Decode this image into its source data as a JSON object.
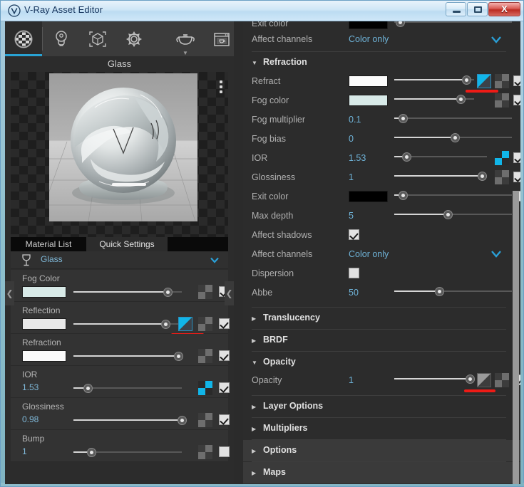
{
  "window": {
    "title": "V-Ray Asset Editor",
    "logo_icon": "vray-logo-icon",
    "minimize_label": "",
    "maximize_label": "",
    "close_label": "X"
  },
  "toolbar": {
    "items": [
      {
        "name": "materials-tab",
        "icon": "checkered-sphere-icon",
        "active": true
      },
      {
        "name": "lights-tab",
        "icon": "light-bulb-icon",
        "active": false
      },
      {
        "name": "geometry-tab",
        "icon": "cube-brackets-icon",
        "active": false
      },
      {
        "name": "settings-tab",
        "icon": "gear-icon",
        "active": false
      },
      {
        "name": "preview-shape-tab",
        "icon": "teapot-icon",
        "active": false
      },
      {
        "name": "render-view-tab",
        "icon": "render-window-icon",
        "active": false
      }
    ]
  },
  "left_panel": {
    "preview_title": "Glass",
    "options_icon": "vertical-dots-icon",
    "tabs": [
      {
        "label": "Material List",
        "active": false
      },
      {
        "label": "Quick Settings",
        "active": true
      }
    ],
    "material": {
      "icon": "wine-glass-icon",
      "name": "Glass",
      "expand_icon": "chevron-down-icon"
    },
    "params": [
      {
        "label": "Fog Color",
        "type": "color",
        "color": "#d8eae8",
        "slider": 0.86,
        "texture": "checker-slot",
        "texture_active": false,
        "gradient": null,
        "checked": true,
        "marked": false
      },
      {
        "label": "Reflection",
        "type": "color",
        "color": "#e8e8e8",
        "slider": 0.84,
        "texture": "checker-slot",
        "texture_active": false,
        "gradient": "gradient-slot",
        "gradient_active": true,
        "checked": true,
        "marked": true
      },
      {
        "label": "Refraction",
        "type": "color",
        "color": "#fbfbfb",
        "slider": 0.94,
        "texture": "checker-slot",
        "texture_active": false,
        "gradient": null,
        "checked": true,
        "marked": false
      },
      {
        "label": "IOR",
        "type": "value",
        "value": "1.53",
        "slider": 0.09,
        "texture": "checker-slot",
        "texture_active": true,
        "gradient": null,
        "checked": true,
        "marked": false
      },
      {
        "label": "Glossiness",
        "type": "value",
        "value": "0.98",
        "slider": 0.97,
        "texture": "checker-slot",
        "texture_active": false,
        "gradient": null,
        "checked": true,
        "marked": false
      },
      {
        "label": "Bump",
        "type": "value",
        "value": "1",
        "slider": 0.13,
        "texture": "checker-slot",
        "texture_active": false,
        "gradient": null,
        "checked": false,
        "marked": false
      }
    ],
    "collapse_icon": "chevron-left-icon"
  },
  "right_panel": {
    "collapse_icon": "chevron-left-icon",
    "top_partial": [
      {
        "label": "Exit color",
        "type": "color",
        "color": "#000000",
        "slider": 0.02,
        "checkbox": null
      },
      {
        "label": "Affect channels",
        "type": "dropdown",
        "value": "Color only",
        "caret": "chevron-down-icon"
      }
    ],
    "sections": [
      {
        "title": "Refraction",
        "expanded": true,
        "arrow": "triangle-down-icon",
        "highlight": false,
        "rows": [
          {
            "label": "Refract",
            "type": "color",
            "color": "#fbfbfb",
            "slider": 0.86,
            "gradient": "gradient-slot",
            "gradient_active": true,
            "texture": "checker-slot",
            "texture_active": false,
            "checked": true,
            "marked": true
          },
          {
            "label": "Fog color",
            "type": "color",
            "color": "#d8eae8",
            "slider": 0.8,
            "gradient": null,
            "texture": "checker-slot",
            "texture_active": false,
            "checked": true,
            "marked": false
          },
          {
            "label": "Fog multiplier",
            "type": "value",
            "value": "0.1",
            "slider": 0.035,
            "gradient": null,
            "texture": null,
            "checked": null,
            "marked": false
          },
          {
            "label": "Fog bias",
            "type": "value",
            "value": "0",
            "slider": 0.5,
            "gradient": null,
            "texture": null,
            "checked": null,
            "marked": false
          },
          {
            "label": "IOR",
            "type": "value",
            "value": "1.53",
            "slider": 0.08,
            "gradient": null,
            "texture": "checker-slot",
            "texture_active": true,
            "checked": true,
            "marked": false
          },
          {
            "label": "Glossiness",
            "type": "value",
            "value": "1",
            "slider": 0.94,
            "gradient": null,
            "texture": "checker-slot",
            "texture_active": false,
            "checked": true,
            "marked": false
          },
          {
            "label": "Exit color",
            "type": "color",
            "color": "#000000",
            "slider": 0.035,
            "gradient": null,
            "texture": null,
            "checked": false,
            "marked": false
          },
          {
            "label": "Max depth",
            "type": "value",
            "value": "5",
            "slider": 0.44,
            "gradient": null,
            "texture": null,
            "checked": null,
            "marked": false
          },
          {
            "label": "Affect shadows",
            "type": "checkbox",
            "checked": true
          },
          {
            "label": "Affect channels",
            "type": "dropdown",
            "value": "Color only",
            "caret": "chevron-down-icon"
          },
          {
            "label": "Dispersion",
            "type": "checkbox",
            "checked": false
          },
          {
            "label": "Abbe",
            "type": "value",
            "value": "50",
            "slider": 0.35,
            "gradient": null,
            "texture": null,
            "checked": null,
            "marked": false
          }
        ]
      },
      {
        "title": "Translucency",
        "expanded": false,
        "arrow": "triangle-right-icon",
        "highlight": false,
        "rows": []
      },
      {
        "title": "BRDF",
        "expanded": false,
        "arrow": "triangle-right-icon",
        "highlight": false,
        "rows": []
      },
      {
        "title": "Opacity",
        "expanded": true,
        "arrow": "triangle-down-icon",
        "highlight": false,
        "rows": [
          {
            "label": "Opacity",
            "type": "value",
            "value": "1",
            "slider": 0.9,
            "gradient": "gradient-slot",
            "gradient_active": false,
            "texture": "checker-slot",
            "texture_active": false,
            "checked": true,
            "marked": true
          }
        ]
      },
      {
        "title": "Layer Options",
        "expanded": false,
        "arrow": "triangle-right-icon",
        "highlight": false,
        "rows": []
      },
      {
        "title": "Multipliers",
        "expanded": false,
        "arrow": "triangle-right-icon",
        "highlight": false,
        "rows": []
      },
      {
        "title": "Options",
        "expanded": false,
        "arrow": "triangle-right-icon",
        "highlight": true,
        "rows": []
      },
      {
        "title": "Maps",
        "expanded": false,
        "arrow": "triangle-right-icon",
        "highlight": true,
        "rows": []
      }
    ]
  },
  "colors": {
    "accent": "#29a3d4",
    "value_text": "#6fb3d8",
    "annotation": "#ee1b16",
    "panel_bg": "#2c2c2c",
    "row_bg": "#333333"
  }
}
